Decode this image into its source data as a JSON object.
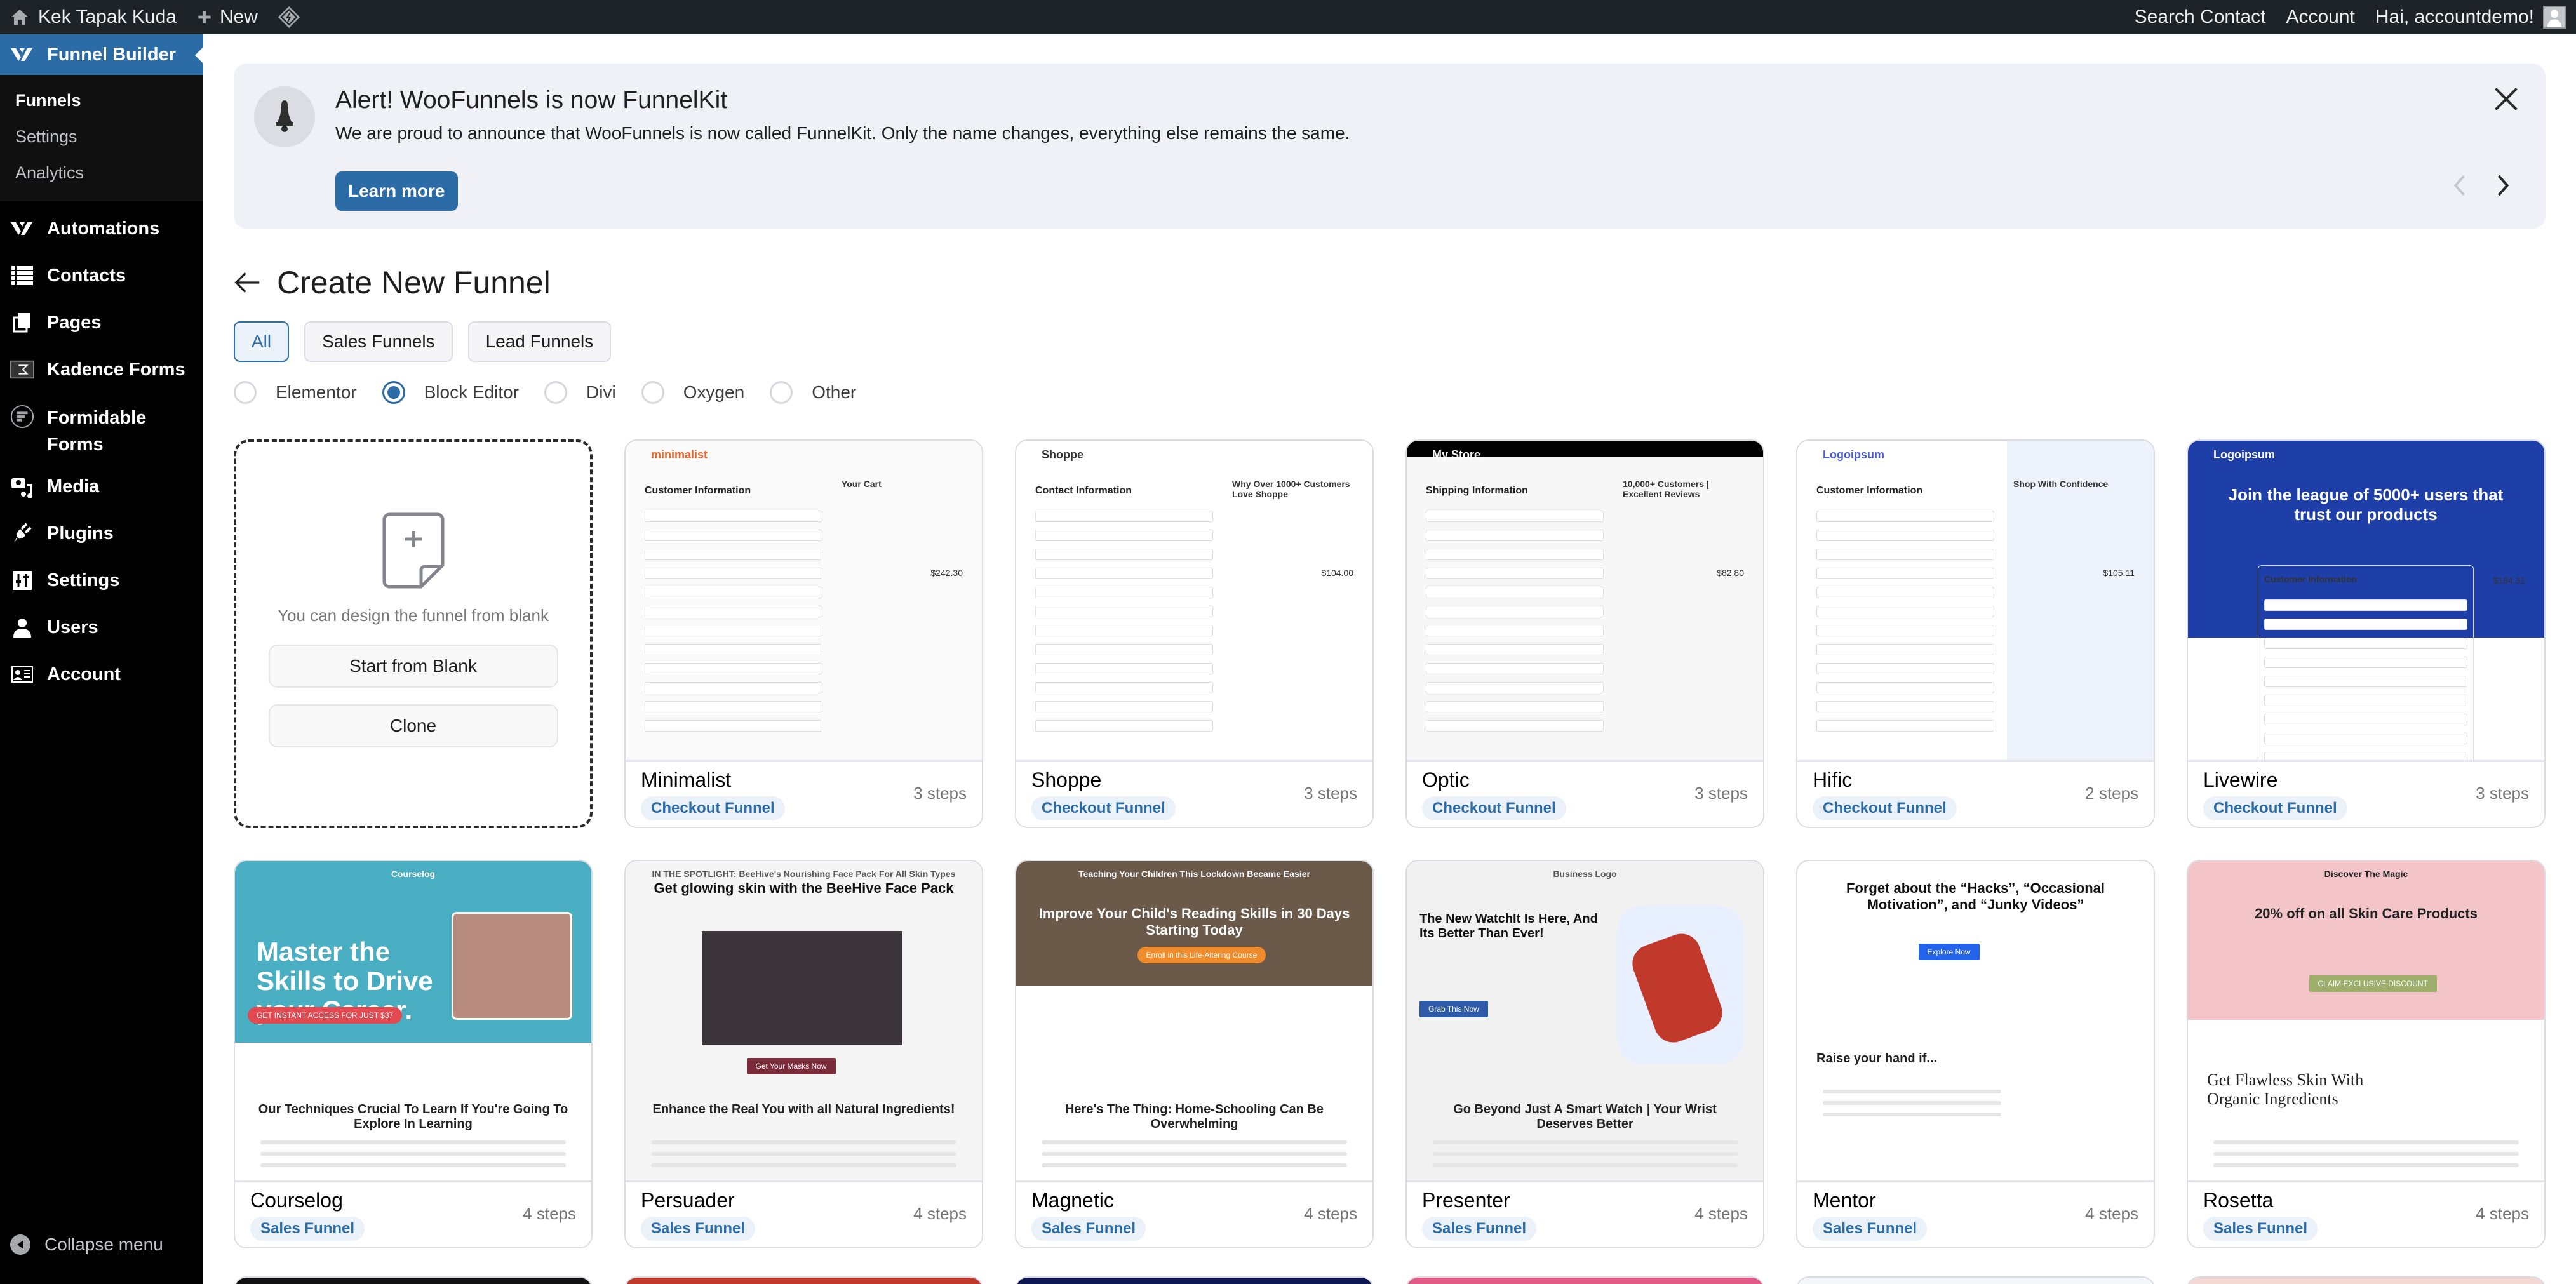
{
  "adminbar": {
    "site_name": "Kek Tapak Kuda",
    "new_label": "New",
    "search_contact": "Search Contact",
    "account": "Account",
    "greeting": "Hai, accountdemo!"
  },
  "sidebar": {
    "active_menu": "Funnel Builder",
    "submenu": [
      "Funnels",
      "Settings",
      "Analytics"
    ],
    "items": [
      {
        "label": "Automations",
        "icon": "funnelkit-icon"
      },
      {
        "label": "Contacts",
        "icon": "list-icon"
      },
      {
        "label": "Pages",
        "icon": "pages-icon"
      },
      {
        "label": "Kadence Forms",
        "icon": "kadence-icon"
      },
      {
        "label": "Formidable Forms",
        "icon": "formidable-icon"
      },
      {
        "label": "Media",
        "icon": "media-icon"
      },
      {
        "label": "Plugins",
        "icon": "plug-icon"
      },
      {
        "label": "Settings",
        "icon": "sliders-icon"
      },
      {
        "label": "Users",
        "icon": "user-icon"
      },
      {
        "label": "Account",
        "icon": "id-card-icon"
      }
    ],
    "collapse_label": "Collapse menu"
  },
  "notice": {
    "title": "Alert! WooFunnels is now FunnelKit",
    "body": "We are proud to announce that WooFunnels is now called FunnelKit. Only the name changes, everything else remains the same.",
    "button": "Learn more"
  },
  "page": {
    "title": "Create New Funnel",
    "tabs": [
      {
        "label": "All",
        "active": true
      },
      {
        "label": "Sales Funnels",
        "active": false
      },
      {
        "label": "Lead Funnels",
        "active": false
      }
    ],
    "builders": [
      {
        "label": "Elementor",
        "selected": false
      },
      {
        "label": "Block Editor",
        "selected": true
      },
      {
        "label": "Divi",
        "selected": false
      },
      {
        "label": "Oxygen",
        "selected": false
      },
      {
        "label": "Other",
        "selected": false
      }
    ]
  },
  "blank_card": {
    "message": "You can design the funnel from blank",
    "start_button": "Start from Blank",
    "clone_button": "Clone"
  },
  "templates": [
    {
      "name": "Minimalist",
      "type": "Checkout Funnel",
      "steps": "3 steps",
      "preview": {
        "brand": "minimalist",
        "headline": "Customer Information",
        "side": "Your Cart",
        "total": "$242.30"
      }
    },
    {
      "name": "Shoppe",
      "type": "Checkout Funnel",
      "steps": "3 steps",
      "preview": {
        "brand": "Shoppe",
        "headline": "Contact Information",
        "side": "Why Over 1000+ Customers Love Shoppe",
        "total": "$104.00"
      }
    },
    {
      "name": "Optic",
      "type": "Checkout Funnel",
      "steps": "3 steps",
      "preview": {
        "brand": "My Store",
        "headline": "Shipping Information",
        "side": "10,000+ Customers | Excellent Reviews",
        "total": "$82.80"
      }
    },
    {
      "name": "Hific",
      "type": "Checkout Funnel",
      "steps": "2 steps",
      "preview": {
        "brand": "Logoipsum",
        "headline": "Customer Information",
        "side": "Shop With Confidence",
        "total": "$105.11"
      }
    },
    {
      "name": "Livewire",
      "type": "Checkout Funnel",
      "steps": "3 steps",
      "preview": {
        "brand": "Logoipsum",
        "headline": "Join the league of 5000+ users that trust our products",
        "side": "Customer Information",
        "total": "$184.31"
      }
    },
    {
      "name": "Courselog",
      "type": "Sales Funnel",
      "steps": "4 steps",
      "preview": {
        "brand": "Courselog",
        "headline": "Master the Skills to Drive your Career.",
        "sub": "Our Techniques Crucial To Learn If You're Going To Explore In Learning",
        "cta": "GET INSTANT ACCESS FOR JUST $37"
      }
    },
    {
      "name": "Persuader",
      "type": "Sales Funnel",
      "steps": "4 steps",
      "preview": {
        "brand": "IN THE SPOTLIGHT: BeeHive's Nourishing Face Pack For All Skin Types",
        "headline": "Get glowing skin with the BeeHive Face Pack",
        "sub": "Enhance the Real You with all Natural Ingredients!",
        "cta": "Get Your Masks Now"
      }
    },
    {
      "name": "Magnetic",
      "type": "Sales Funnel",
      "steps": "4 steps",
      "preview": {
        "brand": "Teaching Your Children This Lockdown Became Easier",
        "headline": "Improve Your Child's Reading Skills in 30 Days Starting Today",
        "sub": "Here's The Thing: Home-Schooling Can Be Overwhelming",
        "cta": "Enroll in this Life-Altering Course"
      }
    },
    {
      "name": "Presenter",
      "type": "Sales Funnel",
      "steps": "4 steps",
      "preview": {
        "brand": "Business Logo",
        "headline": "The New WatchIt Is Here, And Its Better Than Ever!",
        "sub": "Go Beyond Just A Smart Watch | Your Wrist Deserves Better",
        "cta": "Grab This Now"
      }
    },
    {
      "name": "Mentor",
      "type": "Sales Funnel",
      "steps": "4 steps",
      "preview": {
        "brand": "",
        "headline": "Forget about the “Hacks”, “Occasional Motivation”, and “Junky Videos”",
        "sub": "Raise your hand if...",
        "cta": "Explore Now"
      }
    },
    {
      "name": "Rosetta",
      "type": "Sales Funnel",
      "steps": "4 steps",
      "preview": {
        "brand": "Discover The Magic",
        "headline": "20% off on all Skin Care Products",
        "sub": "Get Flawless Skin With Organic Ingredients",
        "cta": "CLAIM EXCLUSIVE DISCOUNT"
      }
    }
  ],
  "next_row_colors": [
    "#111111",
    "#c0392b",
    "#0d1650",
    "#e05a85",
    "#f4f6fa",
    "#f2d7d3"
  ]
}
